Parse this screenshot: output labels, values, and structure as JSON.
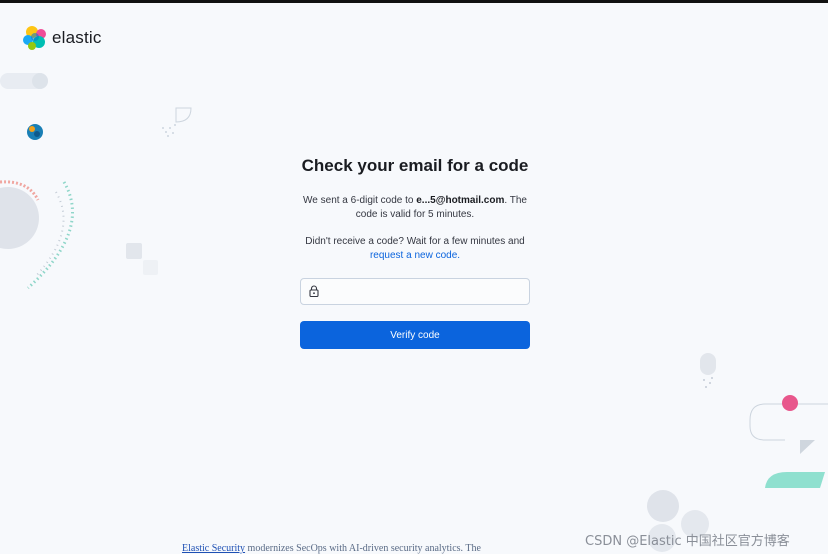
{
  "brand": {
    "name": "elastic",
    "icon": "elastic-logo-icon"
  },
  "heading": "Check your email for a code",
  "message": {
    "prefix": "We sent a 6-digit code to ",
    "email": "e...5@hotmail.com",
    "suffix": ". The code is valid for 5 minutes."
  },
  "resend": {
    "prefix": "Didn't receive a code? Wait for a few minutes and ",
    "link": "request a new code."
  },
  "code_field": {
    "icon": "lock-icon",
    "value": ""
  },
  "verify_button": "Verify code",
  "background_text": {
    "link": "Elastic Security",
    "rest": " modernizes SecOps with AI-driven security analytics. The"
  },
  "watermark": "CSDN @Elastic 中国社区官方博客",
  "colors": {
    "accent": "#0b64dd",
    "background": "#f7f9fc",
    "heading": "#1a1c21"
  }
}
